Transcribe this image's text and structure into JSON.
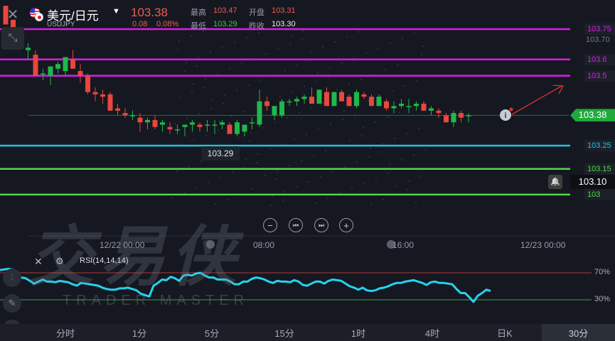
{
  "header": {
    "pair_name": "美元/日元",
    "symbol": "USDJPY",
    "price": "103.38",
    "change": "0.08",
    "change_pct": "0.08%",
    "high_label": "最高",
    "high": "103.47",
    "open_label": "开盘",
    "open": "103.31",
    "low_label": "最低",
    "low": "103.29",
    "prev_close_label": "昨收",
    "prev_close": "103.30"
  },
  "watermark": {
    "main": "交易侠",
    "sub": "TRADER MASTER"
  },
  "time_labels": [
    "12/22 00:00",
    "08:00",
    "16:00",
    "12/23 00:00"
  ],
  "rsi_label": "RSI(14,14,14)",
  "rsi_levels": [
    "70%",
    "30%"
  ],
  "timeframes": [
    "分时",
    "1分",
    "5分",
    "15分",
    "1时",
    "4时",
    "日K",
    "30分"
  ],
  "active_timeframe": "30分",
  "colors": {
    "up": "#1fb84a",
    "down": "#e8463e",
    "magenta": "#d91ee6",
    "cyan": "#22c4e0",
    "green_line": "#52d84a",
    "rsi": "#27d2ee"
  },
  "chart_data": {
    "type": "candlestick",
    "ylim": [
      103.04,
      103.79
    ],
    "price_levels": [
      {
        "label": "103.75",
        "value": 103.75,
        "color": "#d91ee6"
      },
      {
        "label": "103.6",
        "value": 103.62,
        "color": "#d91ee6"
      },
      {
        "label": "103.5",
        "value": 103.55,
        "color": "#d91ee6"
      },
      {
        "label": "103.25",
        "value": 103.25,
        "color": "#22c4e0"
      },
      {
        "label": "103.15",
        "value": 103.15,
        "color": "#52d84a"
      },
      {
        "label": "103",
        "value": 103.04,
        "color": "#52d84a"
      }
    ],
    "axis_ticks": [
      {
        "label": "103.70",
        "value": 103.7
      }
    ],
    "current_price": {
      "label": "103.38",
      "value": 103.38
    },
    "alert_price": {
      "label": "103.10",
      "value": 103.1
    },
    "low_marker": {
      "label": "103.29",
      "value": 103.29
    },
    "candles": [
      [
        103.85,
        103.85,
        103.77,
        103.77
      ],
      [
        103.79,
        103.79,
        103.69,
        103.72
      ],
      [
        103.72,
        103.74,
        103.67,
        103.69
      ],
      [
        103.66,
        103.69,
        103.62,
        103.67
      ],
      [
        103.64,
        103.66,
        103.55,
        103.55
      ],
      [
        103.56,
        103.58,
        103.53,
        103.56
      ],
      [
        103.55,
        103.59,
        103.51,
        103.59
      ],
      [
        103.58,
        103.61,
        103.56,
        103.6
      ],
      [
        103.57,
        103.63,
        103.55,
        103.63
      ],
      [
        103.62,
        103.66,
        103.58,
        103.58
      ],
      [
        103.57,
        103.6,
        103.52,
        103.55
      ],
      [
        103.55,
        103.56,
        103.47,
        103.48
      ],
      [
        103.48,
        103.5,
        103.44,
        103.47
      ],
      [
        103.47,
        103.49,
        103.43,
        103.46
      ],
      [
        103.47,
        103.48,
        103.4,
        103.4
      ],
      [
        103.41,
        103.43,
        103.38,
        103.4
      ],
      [
        103.39,
        103.41,
        103.37,
        103.38
      ],
      [
        103.38,
        103.4,
        103.36,
        103.38
      ],
      [
        103.37,
        103.39,
        103.31,
        103.35
      ],
      [
        103.35,
        103.37,
        103.32,
        103.36
      ],
      [
        103.36,
        103.38,
        103.32,
        103.33
      ],
      [
        103.34,
        103.36,
        103.31,
        103.35
      ],
      [
        103.33,
        103.35,
        103.3,
        103.32
      ],
      [
        103.32,
        103.34,
        103.3,
        103.32
      ],
      [
        103.33,
        103.34,
        103.29,
        103.34
      ],
      [
        103.34,
        103.36,
        103.31,
        103.35
      ],
      [
        103.34,
        103.35,
        103.31,
        103.33
      ],
      [
        103.34,
        103.36,
        103.31,
        103.34
      ],
      [
        103.34,
        103.36,
        103.3,
        103.34
      ],
      [
        103.34,
        103.36,
        103.32,
        103.35
      ],
      [
        103.34,
        103.35,
        103.31,
        103.3
      ],
      [
        103.3,
        103.36,
        103.29,
        103.35
      ],
      [
        103.31,
        103.34,
        103.29,
        103.34
      ],
      [
        103.35,
        103.37,
        103.32,
        103.35
      ],
      [
        103.34,
        103.49,
        103.33,
        103.44
      ],
      [
        103.44,
        103.46,
        103.4,
        103.42
      ],
      [
        103.38,
        103.4,
        103.36,
        103.42
      ],
      [
        103.38,
        103.45,
        103.37,
        103.44
      ],
      [
        103.44,
        103.45,
        103.42,
        103.44
      ],
      [
        103.44,
        103.46,
        103.42,
        103.45
      ],
      [
        103.45,
        103.47,
        103.43,
        103.46
      ],
      [
        103.46,
        103.5,
        103.45,
        103.43
      ],
      [
        103.43,
        103.49,
        103.43,
        103.49
      ],
      [
        103.48,
        103.5,
        103.44,
        103.42
      ],
      [
        103.42,
        103.48,
        103.42,
        103.48
      ],
      [
        103.48,
        103.49,
        103.45,
        103.44
      ],
      [
        103.46,
        103.47,
        103.42,
        103.42
      ],
      [
        103.42,
        103.49,
        103.41,
        103.48
      ],
      [
        103.47,
        103.48,
        103.45,
        103.46
      ],
      [
        103.46,
        103.47,
        103.43,
        103.42
      ],
      [
        103.42,
        103.47,
        103.42,
        103.46
      ],
      [
        103.44,
        103.45,
        103.4,
        103.41
      ],
      [
        103.41,
        103.44,
        103.39,
        103.42
      ],
      [
        103.42,
        103.45,
        103.41,
        103.43
      ],
      [
        103.42,
        103.45,
        103.39,
        103.42
      ],
      [
        103.42,
        103.44,
        103.4,
        103.43
      ],
      [
        103.43,
        103.44,
        103.4,
        103.4
      ],
      [
        103.4,
        103.42,
        103.38,
        103.41
      ],
      [
        103.4,
        103.41,
        103.37,
        103.39
      ],
      [
        103.38,
        103.39,
        103.35,
        103.35
      ],
      [
        103.35,
        103.4,
        103.33,
        103.39
      ],
      [
        103.39,
        103.4,
        103.35,
        103.37
      ],
      [
        103.38,
        103.39,
        103.35,
        103.38
      ]
    ],
    "rsi": [
      74,
      75,
      76,
      75,
      64,
      63,
      62,
      58,
      54,
      57,
      60,
      57,
      57,
      56,
      58,
      57,
      56,
      53,
      51,
      55,
      54,
      53,
      52,
      51,
      48,
      46,
      45,
      45,
      47,
      47,
      48,
      46,
      44,
      39,
      37,
      35,
      51,
      55,
      60,
      59,
      64,
      62,
      58,
      66,
      67,
      66,
      69,
      70,
      66,
      63,
      63,
      60,
      60,
      60,
      57,
      53,
      53,
      57,
      57,
      61,
      63,
      62,
      60,
      57,
      55,
      58,
      57,
      57,
      56,
      59,
      57,
      52,
      51,
      54,
      57,
      57,
      54,
      58,
      60,
      59,
      58,
      54,
      50,
      48,
      45,
      48,
      44,
      43,
      44,
      47,
      48,
      50,
      53,
      55,
      55,
      57,
      58,
      59,
      57,
      55,
      52,
      56,
      57,
      55,
      55,
      54,
      53,
      46,
      40,
      40,
      34,
      27,
      36,
      40,
      45,
      43
    ]
  }
}
